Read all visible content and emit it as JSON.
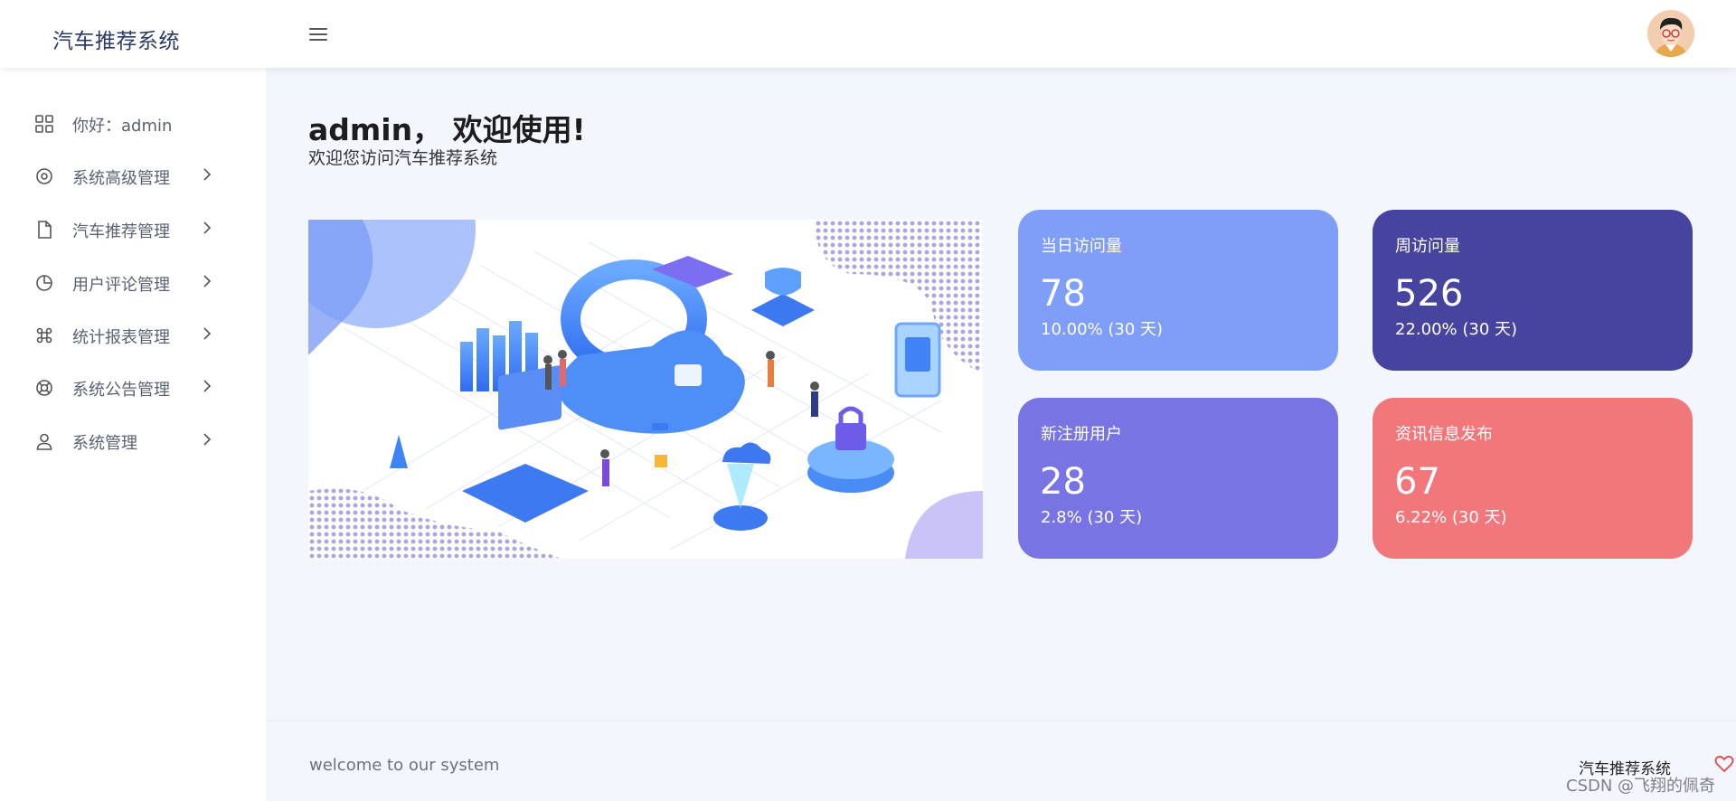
{
  "header": {
    "app_title": "汽车推荐系统",
    "menu_icon": "hamburger-icon",
    "avatar_icon": "user-avatar"
  },
  "sidebar": {
    "items": [
      {
        "label": "你好：admin",
        "icon": "grid-icon",
        "has_submenu": false
      },
      {
        "label": "系统高级管理",
        "icon": "target-icon",
        "has_submenu": true
      },
      {
        "label": "汽车推荐管理",
        "icon": "file-icon",
        "has_submenu": true
      },
      {
        "label": "用户评论管理",
        "icon": "pie-chart-icon",
        "has_submenu": true
      },
      {
        "label": "统计报表管理",
        "icon": "command-icon",
        "has_submenu": true
      },
      {
        "label": "系统公告管理",
        "icon": "lifebuoy-icon",
        "has_submenu": true
      },
      {
        "label": "系统管理",
        "icon": "user-icon",
        "has_submenu": true
      }
    ]
  },
  "main": {
    "welcome_title": "admin， 欢迎使用!",
    "welcome_subtitle": "欢迎您访问汽车推荐系统",
    "hero_image": "isometric-tech-illustration"
  },
  "stats": [
    {
      "title": "当日访问量",
      "value": "78",
      "change": "10.00% (30 天)",
      "color": "#7f9ef8"
    },
    {
      "title": "周访问量",
      "value": "526",
      "change": "22.00% (30 天)",
      "color": "#47449f"
    },
    {
      "title": "新注册用户",
      "value": "28",
      "change": "2.8% (30 天)",
      "color": "#7874e3"
    },
    {
      "title": "资讯信息发布",
      "value": "67",
      "change": "6.22% (30 天)",
      "color": "#f2777b"
    }
  ],
  "footer": {
    "left_text": "welcome to our system",
    "right_text": "汽车推荐系统",
    "heart_icon": "heart-icon"
  },
  "watermark": "CSDN @飞翔的佩奇"
}
